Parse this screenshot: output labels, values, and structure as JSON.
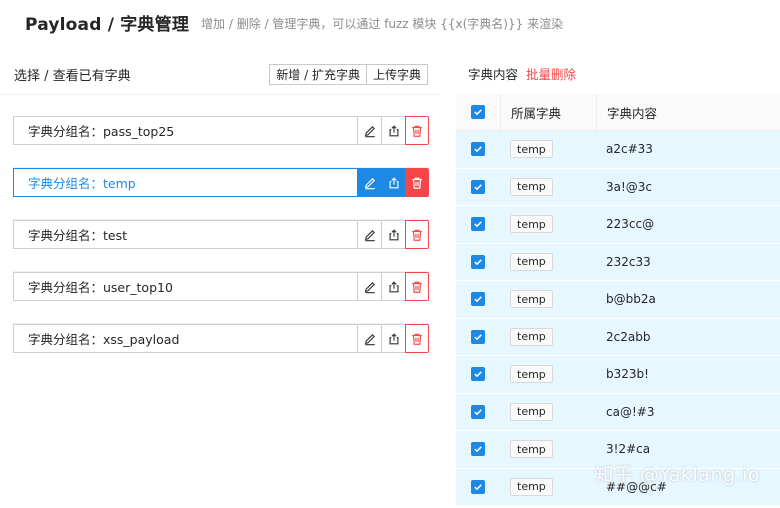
{
  "header": {
    "title": "Payload / 字典管理",
    "subtitle": "增加 / 删除 / 管理字典，可以通过 fuzz 模块 {{x(字典名)}} 来渲染"
  },
  "left": {
    "label": "选择 / 查看已有字典",
    "add_button": "新增 / 扩充字典",
    "upload_button": "上传字典",
    "groups": [
      {
        "label": "字典分组名：pass_top25"
      },
      {
        "label": "字典分组名：temp"
      },
      {
        "label": "字典分组名：test"
      },
      {
        "label": "字典分组名：user_top10"
      },
      {
        "label": "字典分组名：xss_payload"
      }
    ]
  },
  "right": {
    "label": "字典内容",
    "batch_delete": "批量删除",
    "columns": {
      "dict": "所属字典",
      "content": "字典内容"
    },
    "rows": [
      {
        "dict": "temp",
        "content": "a2c#33"
      },
      {
        "dict": "temp",
        "content": "3a!@3c"
      },
      {
        "dict": "temp",
        "content": "223cc@"
      },
      {
        "dict": "temp",
        "content": "232c33"
      },
      {
        "dict": "temp",
        "content": "b@bb2a"
      },
      {
        "dict": "temp",
        "content": "2c2abb"
      },
      {
        "dict": "temp",
        "content": "b323b!"
      },
      {
        "dict": "temp",
        "content": "ca@!#3"
      },
      {
        "dict": "temp",
        "content": "3!2#ca"
      },
      {
        "dict": "temp",
        "content": "##@@c#"
      }
    ]
  },
  "watermark": "知乎 @Yaklang.io",
  "colors": {
    "accent": "#1e88e5",
    "danger": "#f5464a",
    "row_selected": "#e6f7ff"
  }
}
